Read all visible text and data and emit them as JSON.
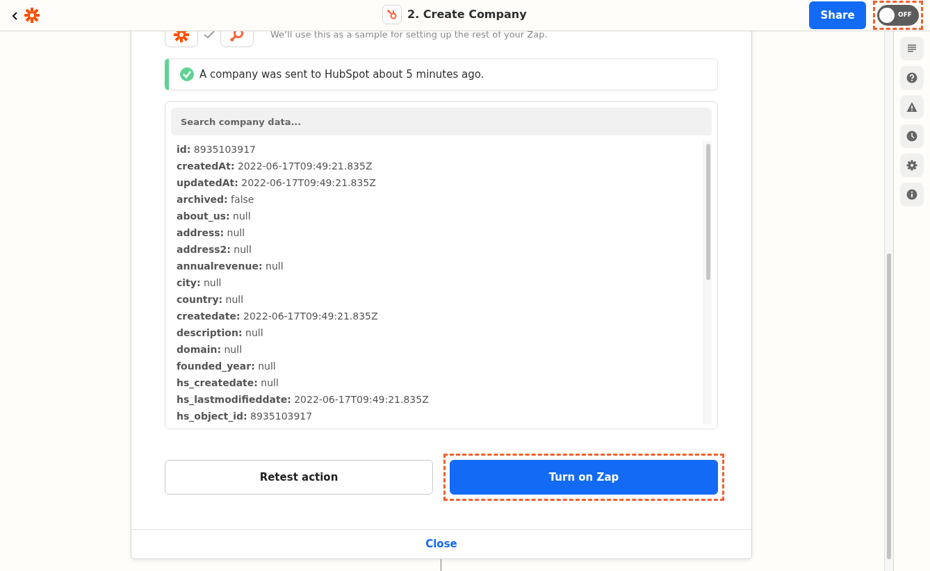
{
  "topbar": {
    "title": "2. Create Company",
    "share": "Share",
    "toggle": {
      "label": "OFF",
      "on": false,
      "highlighted": true
    }
  },
  "sample_note": "We’ll use this as a sample for setting up the rest of your Zap.",
  "alert": {
    "text": "A company was sent to HubSpot about 5 minutes ago."
  },
  "search": {
    "placeholder": "Search company data..."
  },
  "fields": [
    {
      "key": "id:",
      "value": "8935103917"
    },
    {
      "key": "createdAt:",
      "value": "2022-06-17T09:49:21.835Z"
    },
    {
      "key": "updatedAt:",
      "value": "2022-06-17T09:49:21.835Z"
    },
    {
      "key": "archived:",
      "value": "false"
    },
    {
      "key": "about_us:",
      "value": "null"
    },
    {
      "key": "address:",
      "value": "null"
    },
    {
      "key": "address2:",
      "value": "null"
    },
    {
      "key": "annualrevenue:",
      "value": "null"
    },
    {
      "key": "city:",
      "value": "null"
    },
    {
      "key": "country:",
      "value": "null"
    },
    {
      "key": "createdate:",
      "value": "2022-06-17T09:49:21.835Z"
    },
    {
      "key": "description:",
      "value": "null"
    },
    {
      "key": "domain:",
      "value": "null"
    },
    {
      "key": "founded_year:",
      "value": "null"
    },
    {
      "key": "hs_createdate:",
      "value": "null"
    },
    {
      "key": "hs_lastmodifieddate:",
      "value": "2022-06-17T09:49:21.835Z"
    },
    {
      "key": "hs_object_id:",
      "value": "8935103917"
    }
  ],
  "buttons": [
    {
      "label": "Retest action",
      "kind": "secondary",
      "highlighted": false
    },
    {
      "label": "Turn on Zap",
      "kind": "primary",
      "highlighted": true
    }
  ],
  "close": "Close",
  "sidebar": [
    {
      "kind": "notes"
    },
    {
      "kind": "help"
    },
    {
      "kind": "warning"
    },
    {
      "kind": "history"
    },
    {
      "kind": "settings"
    },
    {
      "kind": "info"
    }
  ]
}
